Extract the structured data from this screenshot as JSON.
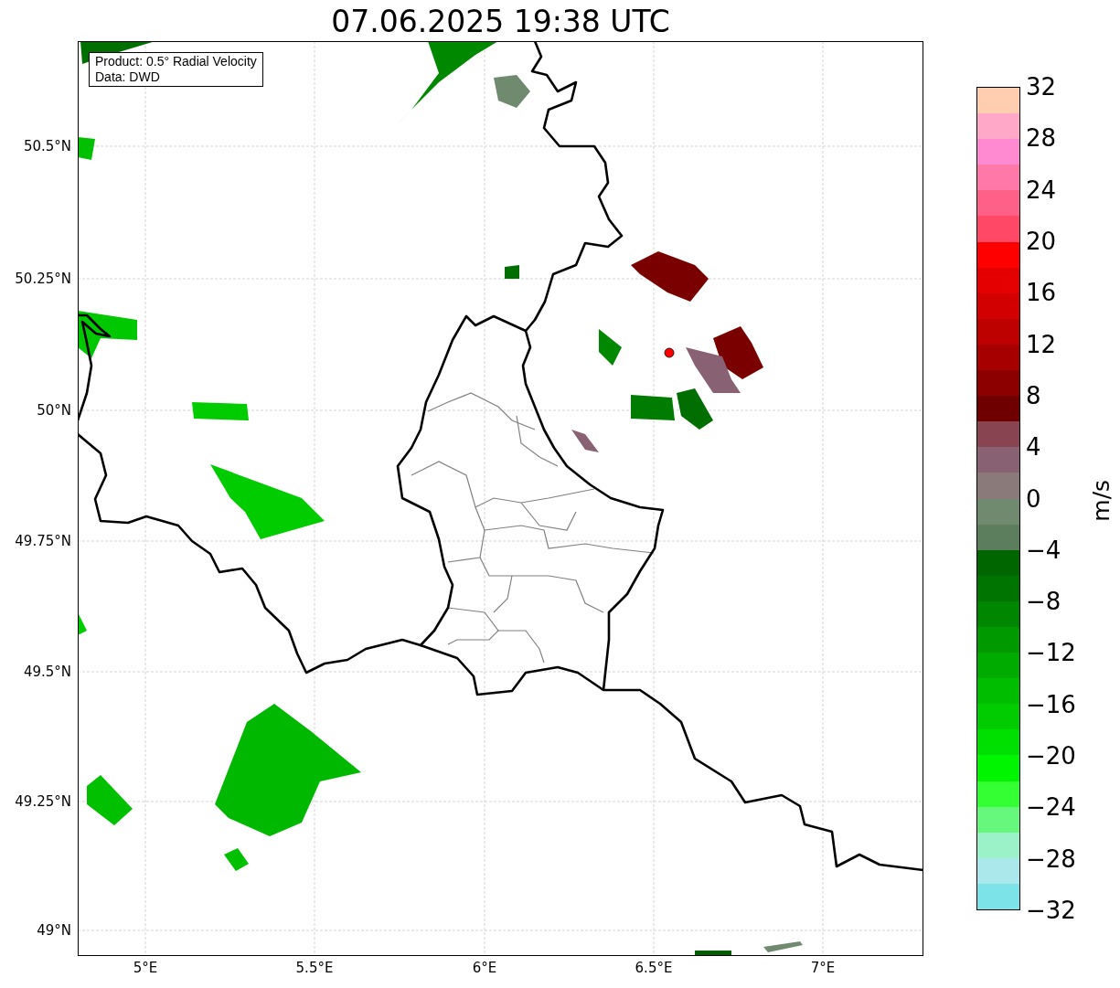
{
  "title": "07.06.2025 19:38 UTC",
  "legend": [
    "Product: 0.5° Radial Velocity",
    "Data: DWD"
  ],
  "lat_ticks": [
    "50.5°N",
    "50.25°N",
    "50°N",
    "49.75°N",
    "49.5°N",
    "49.25°N",
    "49°N"
  ],
  "lon_ticks": [
    "5°E",
    "5.5°E",
    "6°E",
    "6.5°E",
    "7°E"
  ],
  "colorbar": {
    "label": "m/s",
    "ticks": [
      "32",
      "28",
      "24",
      "20",
      "16",
      "12",
      "8",
      "4",
      "0",
      "−4",
      "−8",
      "−12",
      "−16",
      "−20",
      "−24",
      "−28",
      "−32"
    ],
    "segments": [
      {
        "color": "#ffcdb0"
      },
      {
        "color": "#ffa8c8"
      },
      {
        "color": "#ff8ad2"
      },
      {
        "color": "#ff78a8"
      },
      {
        "color": "#ff6088"
      },
      {
        "color": "#ff4866"
      },
      {
        "color": "#ff0000"
      },
      {
        "color": "#e40000"
      },
      {
        "color": "#d20000"
      },
      {
        "color": "#bd0000"
      },
      {
        "color": "#a60000"
      },
      {
        "color": "#8c0000"
      },
      {
        "color": "#6e0000"
      },
      {
        "color": "#884450"
      },
      {
        "color": "#886272"
      },
      {
        "color": "#8a7a7a"
      },
      {
        "color": "#708a70"
      },
      {
        "color": "#5c7e5c"
      },
      {
        "color": "#006600"
      },
      {
        "color": "#007400"
      },
      {
        "color": "#008600"
      },
      {
        "color": "#009a00"
      },
      {
        "color": "#00ab00"
      },
      {
        "color": "#00bd00"
      },
      {
        "color": "#00cc00"
      },
      {
        "color": "#00e000"
      },
      {
        "color": "#00f600"
      },
      {
        "color": "#33ff33"
      },
      {
        "color": "#66f87c"
      },
      {
        "color": "#9cf2c8"
      },
      {
        "color": "#aae8ec"
      },
      {
        "color": "#7ce4e8"
      }
    ]
  }
}
